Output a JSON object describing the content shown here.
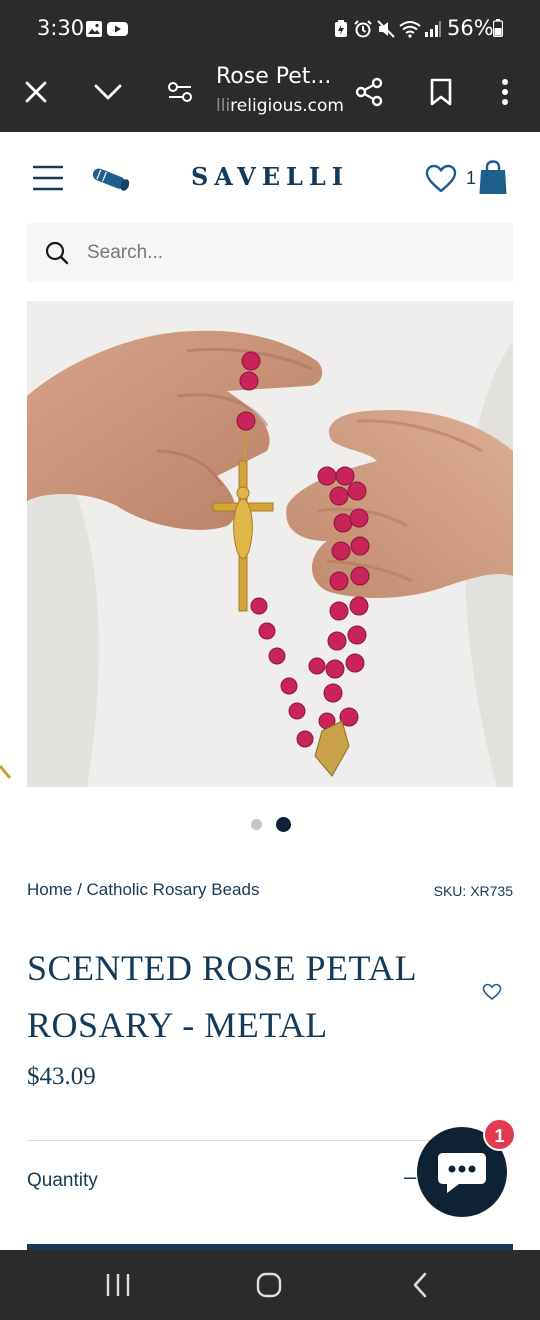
{
  "status_bar": {
    "time": "3:30",
    "battery": "56%"
  },
  "browser": {
    "tab_title": "Rose Pet...",
    "url_faded": "lli",
    "url_main": "religious.com",
    "icons": [
      "close-icon",
      "chevron-down-icon",
      "page-settings-icon",
      "share-icon",
      "bookmark-icon",
      "more-vertical-icon"
    ]
  },
  "site": {
    "logo": "SAVELLI",
    "wishlist_count": "1",
    "search_placeholder": "Search..."
  },
  "product": {
    "breadcrumb_home": "Home",
    "breadcrumb_sep": " / ",
    "breadcrumb_category": "Catholic Rosary Beads",
    "sku": "SKU: XR735",
    "title_line1": "SCENTED ROSE PETAL",
    "title_line2": "ROSARY - METAL",
    "price": "$43.09",
    "quantity_label": "Quantity",
    "quantity_minus": "–"
  },
  "carousel": {
    "total": 2,
    "active": 2
  },
  "chat": {
    "badge": "1"
  },
  "colors": {
    "brand_navy": "#143a5a",
    "rosary_pink": "#c8245a",
    "crucifix_gold": "#d4a43a",
    "chat_bg": "#0e2233",
    "badge_red": "#e23a4e"
  }
}
